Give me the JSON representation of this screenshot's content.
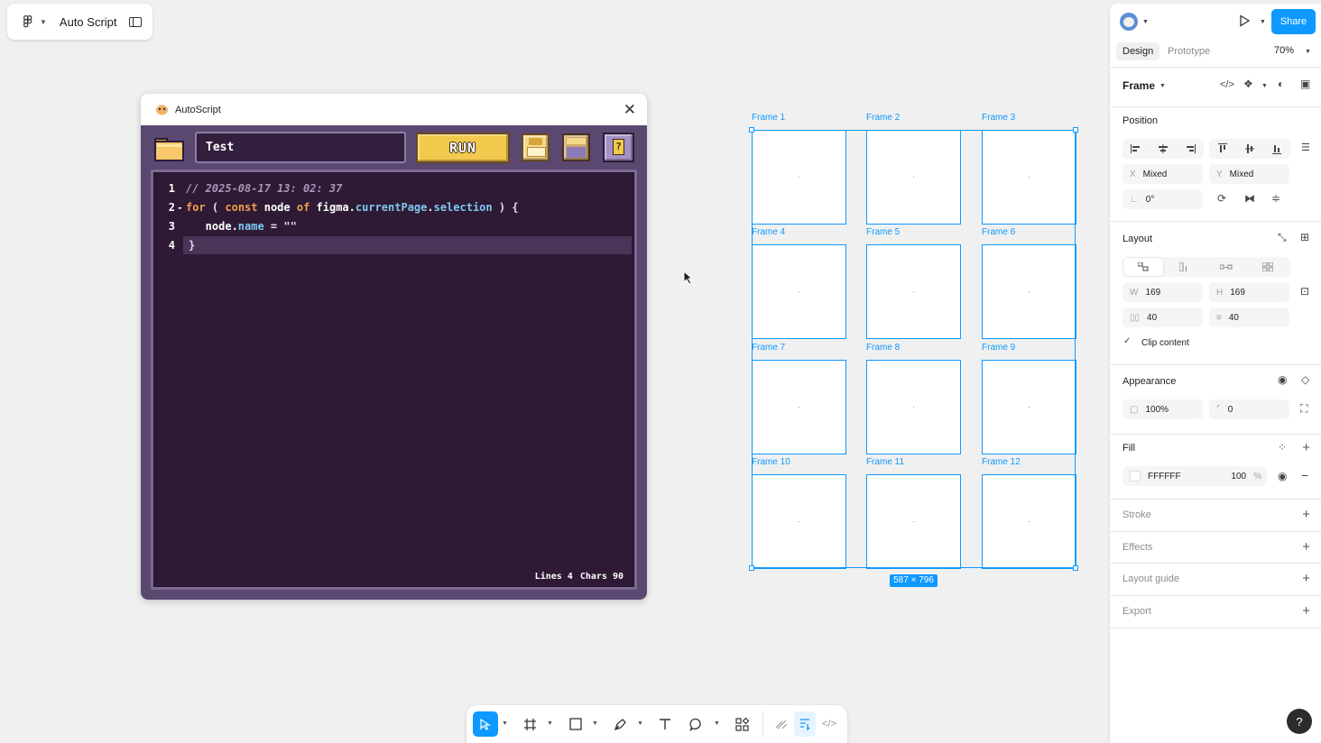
{
  "file": {
    "name": "Auto Script"
  },
  "plugin": {
    "title": "AutoScript",
    "name_input": "Test",
    "run_label": "RUN",
    "help_label": "?",
    "code_lines": [
      {
        "n": "1",
        "fold": "",
        "tokens": [
          {
            "t": "// 2025-08-17 13: 02: 37",
            "c": "c-comment"
          }
        ]
      },
      {
        "n": "2",
        "fold": "-",
        "tokens": [
          {
            "t": "for",
            "c": "c-kw"
          },
          {
            "t": " ( ",
            "c": "c-punct"
          },
          {
            "t": "const",
            "c": "c-kw"
          },
          {
            "t": " node ",
            "c": "c-id"
          },
          {
            "t": "of",
            "c": "c-kw"
          },
          {
            "t": " figma.",
            "c": "c-id"
          },
          {
            "t": "currentPage",
            "c": "c-prop"
          },
          {
            "t": ".",
            "c": "c-id"
          },
          {
            "t": "selection",
            "c": "c-prop"
          },
          {
            "t": " ) {",
            "c": "c-punct"
          }
        ]
      },
      {
        "n": "3",
        "fold": "",
        "tokens": [
          {
            "t": "   node.",
            "c": "c-id"
          },
          {
            "t": "name",
            "c": "c-prop"
          },
          {
            "t": " = \"\"",
            "c": "c-punct"
          }
        ]
      },
      {
        "n": "4",
        "fold": "",
        "tokens": [
          {
            "t": "}",
            "c": "c-punct"
          }
        ]
      }
    ],
    "status_lines": "Lines 4",
    "status_chars": "Chars 90"
  },
  "canvas": {
    "frames": [
      "Frame 1",
      "Frame 2",
      "Frame 3",
      "Frame 4",
      "Frame 5",
      "Frame 6",
      "Frame 7",
      "Frame 8",
      "Frame 9",
      "Frame 10",
      "Frame 11",
      "Frame 12"
    ],
    "size_badge": "587 × 796"
  },
  "right_panel": {
    "share_label": "Share",
    "tabs": [
      "Design",
      "Prototype"
    ],
    "zoom": "70%",
    "frame_type": "Frame",
    "position": {
      "title": "Position",
      "x_label": "X",
      "x": "Mixed",
      "y_label": "Y",
      "y": "Mixed",
      "rotation": "0°"
    },
    "layout": {
      "title": "Layout",
      "w_label": "W",
      "w": "169",
      "h_label": "H",
      "h": "169",
      "gap_h": "40",
      "gap_v": "40",
      "clip_content": "Clip content"
    },
    "appearance": {
      "title": "Appearance",
      "opacity": "100%",
      "radius": "0"
    },
    "fill": {
      "title": "Fill",
      "color": "FFFFFF",
      "opacity": "100",
      "unit": "%"
    },
    "stroke": {
      "title": "Stroke"
    },
    "effects": {
      "title": "Effects"
    },
    "layout_guide": {
      "title": "Layout guide"
    },
    "export": {
      "title": "Export"
    }
  },
  "help_label": "?",
  "colors": {
    "accent": "#0d99ff",
    "plugin_bg": "#5a4870",
    "editor_bg": "#2e1a35",
    "run": "#f2c94c"
  }
}
